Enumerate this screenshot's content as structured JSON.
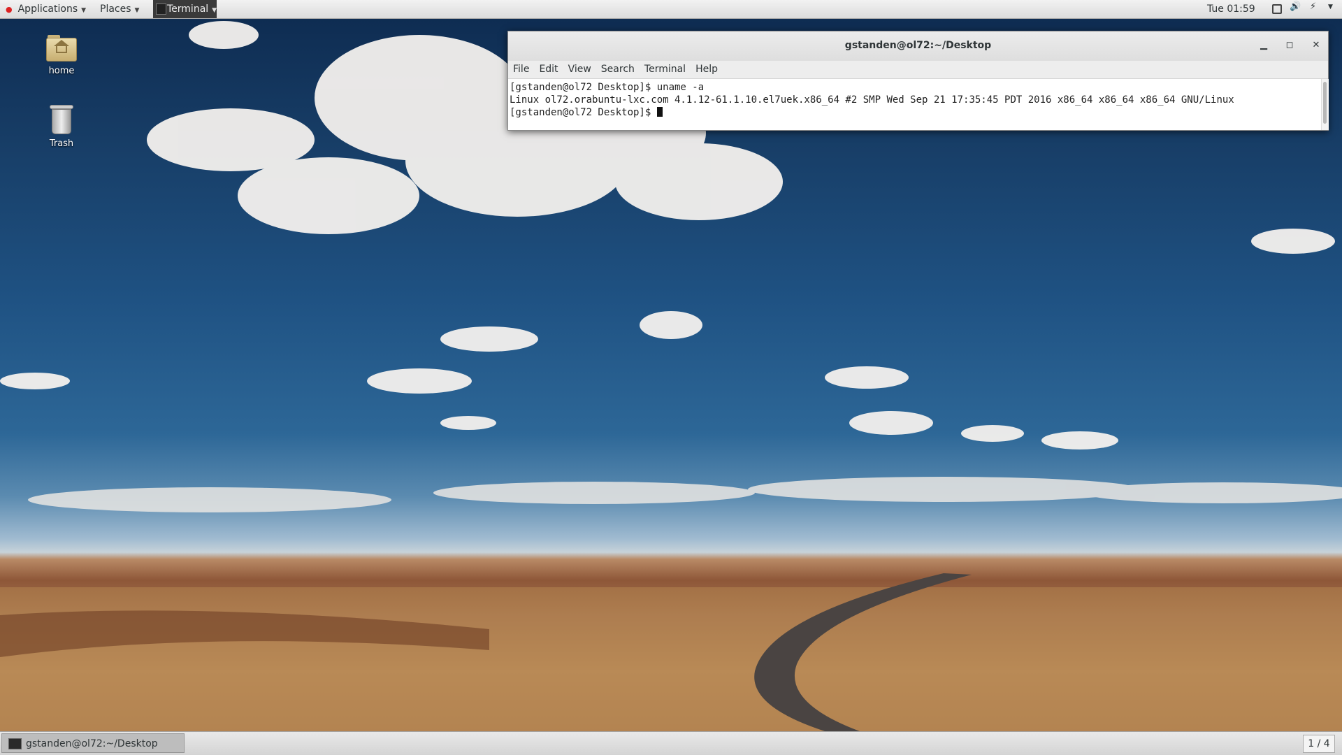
{
  "top_panel": {
    "applications_label": "Applications",
    "places_label": "Places",
    "taskbar_label": "Terminal",
    "clock": "Tue 01:59"
  },
  "desktop_icons": [
    {
      "label": "home"
    },
    {
      "label": "Trash"
    }
  ],
  "terminal": {
    "title": "gstanden@ol72:~/Desktop",
    "menu": [
      "File",
      "Edit",
      "View",
      "Search",
      "Terminal",
      "Help"
    ],
    "lines": [
      "[gstanden@ol72 Desktop]$ uname -a",
      "Linux ol72.orabuntu-lxc.com 4.1.12-61.1.10.el7uek.x86_64 #2 SMP Wed Sep 21 17:35:45 PDT 2016 x86_64 x86_64 x86_64 GNU/Linux",
      "[gstanden@ol72 Desktop]$ "
    ]
  },
  "bottom_panel": {
    "task_label": "gstanden@ol72:~/Desktop",
    "workspace": "1 / 4"
  },
  "icons": {
    "window_min": "minimize-icon",
    "window_max": "maximize-icon",
    "window_close": "close-icon"
  }
}
